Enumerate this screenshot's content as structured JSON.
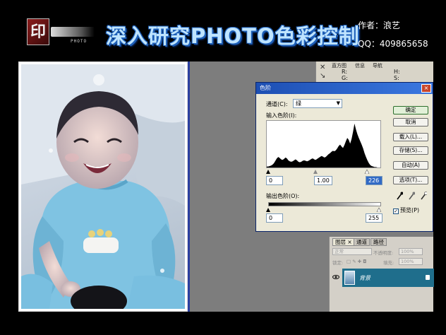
{
  "header": {
    "logo_text": "印",
    "logo_sub": "PHOTO",
    "title": "深入研究PHOTO色彩控制",
    "author": "作者：浪艺",
    "qq": "QQ：409865658"
  },
  "palette": {
    "tabs": [
      "直方图",
      "信息",
      "导航"
    ],
    "info_labels": [
      "R:",
      "G:",
      "H:",
      "S:"
    ]
  },
  "levels_dialog": {
    "title": "色阶",
    "channel_label": "通道(C):",
    "channel_value": "绿",
    "input_label": "输入色阶(I):",
    "input_black": "0",
    "input_gamma": "1.00",
    "input_white": "226",
    "output_label": "输出色阶(O):",
    "output_black": "0",
    "output_white": "255",
    "buttons": {
      "ok": "确定",
      "cancel": "取消",
      "load": "载入(L)...",
      "save": "存储(S)...",
      "auto": "自动(A)",
      "options": "选项(T)..."
    },
    "preview_label": "预览(P)",
    "preview_checked": true,
    "close_label": "×"
  },
  "layers": {
    "tabs": [
      "图层",
      "通道",
      "路径"
    ],
    "blend_mode": "正常",
    "opacity_label": "不透明度:",
    "opacity_value": "100%",
    "lock_label": "锁定:",
    "fill_label": "填充:",
    "fill_value": "100%",
    "layer_name": "背景"
  },
  "histogram_values": [
    2,
    2,
    3,
    4,
    6,
    9,
    14,
    19,
    22,
    20,
    17,
    16,
    18,
    21,
    19,
    15,
    13,
    12,
    13,
    15,
    17,
    15,
    12,
    11,
    12,
    14,
    15,
    14,
    13,
    14,
    16,
    18,
    19,
    17,
    16,
    18,
    20,
    22,
    24,
    23,
    21,
    22,
    25,
    28,
    30,
    33,
    35,
    34,
    36,
    40,
    45,
    48,
    44,
    41,
    47,
    55,
    62,
    58,
    50,
    60,
    75,
    92,
    80,
    70,
    62,
    55,
    48,
    40,
    30,
    22,
    15,
    9,
    5,
    3,
    2,
    1,
    1,
    0,
    0,
    0
  ]
}
